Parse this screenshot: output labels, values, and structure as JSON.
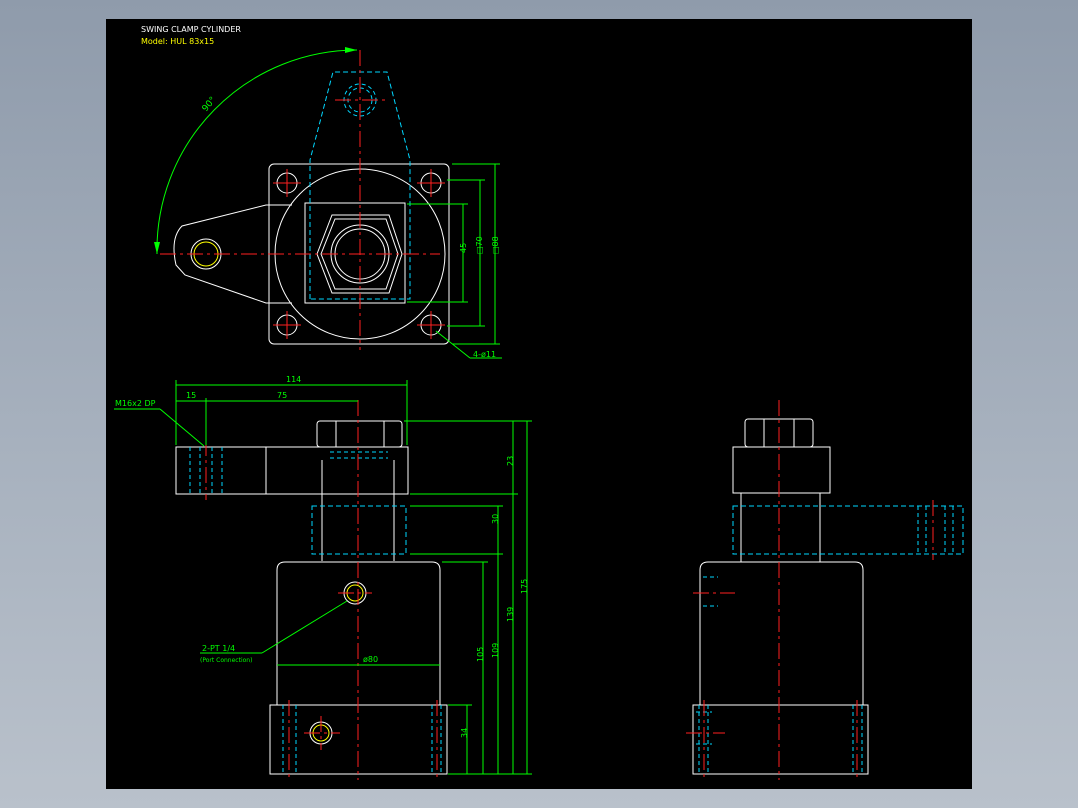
{
  "title_block": {
    "title": "SWING CLAMP CYLINDER",
    "model": "Model: HUL 83x15"
  },
  "top_view": {
    "angle_label": "90°",
    "dims": {
      "d45": "45",
      "d70": "□70",
      "d88": "□88",
      "holes": "4-ø11"
    }
  },
  "front_view": {
    "dims": {
      "width_114": "114",
      "offset_15": "15",
      "length_75": "75",
      "thread": "M16x2 DP",
      "h23": "23",
      "h30": "30",
      "h175": "175",
      "h139": "139",
      "h109": "109",
      "h105": "105",
      "h34": "34",
      "dia80": "ø80",
      "port": "2-PT 1/4",
      "port_note": "(Port Connection)"
    }
  },
  "colors": {
    "background": "#000000",
    "outline": "#ffffff",
    "center_line": "#ff2020",
    "dimension": "#00ff00",
    "hidden": "#00d7ff",
    "port": "#ffff00"
  }
}
